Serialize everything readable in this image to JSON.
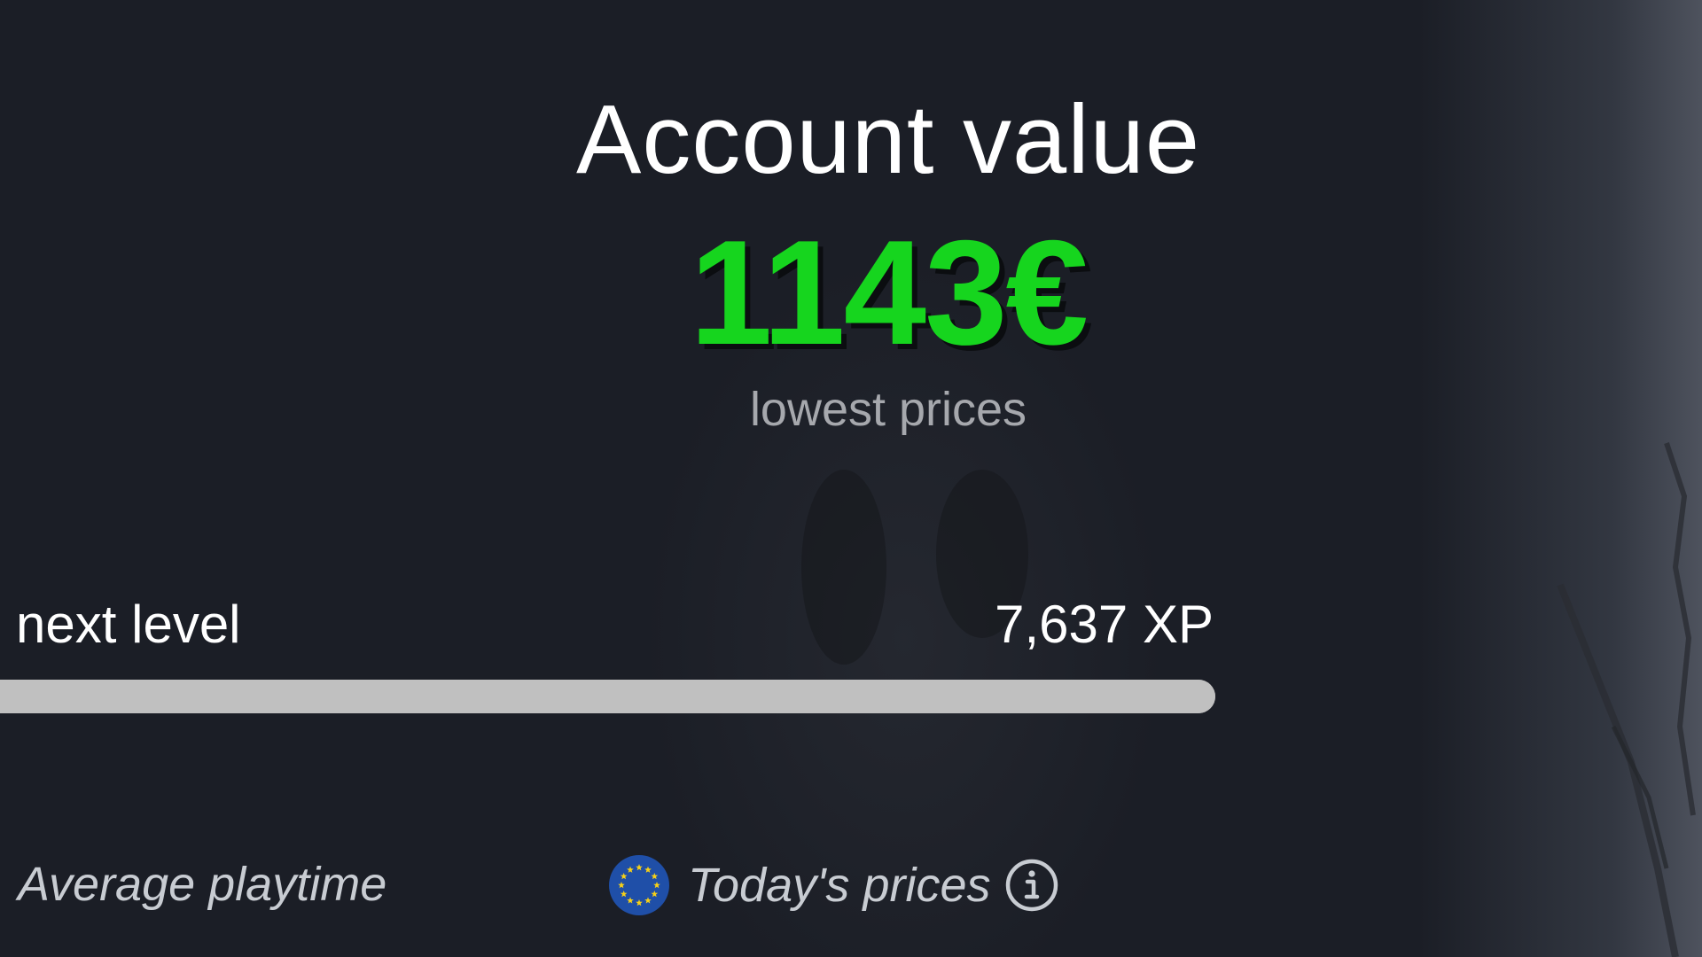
{
  "account": {
    "title": "Account value",
    "value": "1143€",
    "price_basis": "lowest prices"
  },
  "level": {
    "label": "o next level",
    "xp": "7,637 XP",
    "progress_fraction": 1.0
  },
  "footer": {
    "playtime_label": "Average playtime",
    "prices_label": "Today's prices",
    "region_icon": "eu-flag-icon",
    "info_icon": "info-icon"
  },
  "colors": {
    "background": "#1b1e26",
    "value_green": "#16d51e",
    "subtitle_gray": "#a6a8ad",
    "progress_bar": "#c0c0c0",
    "eu_blue": "#1f4fa8",
    "eu_star": "#f7d117"
  }
}
